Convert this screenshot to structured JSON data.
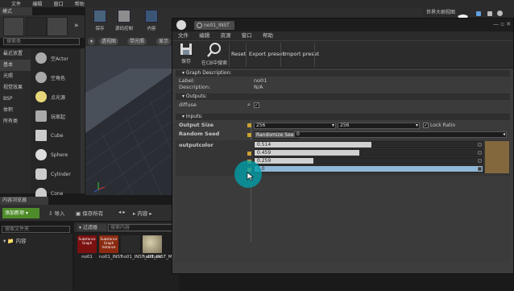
{
  "editor_menu": [
    "文件",
    "编辑",
    "窗口",
    "帮助"
  ],
  "modes": {
    "tab_label": "模式",
    "search_placeholder": "搜索类",
    "categories": [
      "最近放置",
      "基本",
      "光照",
      "视觉效果",
      "BSP",
      "体积",
      "所有类"
    ],
    "items": [
      "空Actor",
      "空角色",
      "点光源",
      "玩家起",
      "Cube",
      "Sphere",
      "Cylinder",
      "Cone"
    ]
  },
  "level_toolbar": {
    "save": "保存",
    "source_control": "源码控制",
    "content": "内容"
  },
  "viewport": {
    "perspective": "透视图",
    "lit": "带光照",
    "show": "显示"
  },
  "outliner_title": "世界大纲视图",
  "content_browser": {
    "tab": "内容浏览器",
    "add_new": "添加新项",
    "import": "导入",
    "save_all": "保存所有",
    "path": "内容",
    "filter_placeholder": "搜索文件夹",
    "filters": "过滤器",
    "search_placeholder": "搜索内容",
    "tree_folder": "内容",
    "assets": [
      {
        "name": "no01",
        "thumb": "Substance Graph",
        "color": "#7a1010"
      },
      {
        "name": "no01_INST",
        "thumb": "Substance Graph Instance",
        "color": "#8a2a10"
      },
      {
        "name": "no01_INST_diffuse",
        "thumb": "",
        "color": "#2a2a2a"
      },
      {
        "name": "no01_INST_MAT",
        "thumb": "",
        "color": "#a49a7a"
      }
    ]
  },
  "material_window": {
    "tab_title": "no01_INST",
    "menu": [
      "文件",
      "编辑",
      "资源",
      "窗口",
      "帮助"
    ],
    "toolbar": {
      "save": "保存",
      "find_in_cb": "在CB中搜索",
      "reset": "Reset",
      "export_preset": "Export preset",
      "import_preset": "Import preset"
    },
    "graph_description": {
      "section": "Graph Description:",
      "label_key": "Label:",
      "label_value": "no01",
      "description_key": "Description:",
      "description_value": "N/A"
    },
    "outputs": {
      "section": "Outputs:",
      "diffuse": "diffuse"
    },
    "inputs": {
      "section": "Inputs:",
      "output_size_label": "Output Size",
      "output_size_x": "256",
      "output_size_y": "256",
      "lock_ratio": "Lock Ratio",
      "random_seed_label": "Random Seed",
      "randomize_button": "Randomize Seed",
      "random_seed_value": "0",
      "outputcolor_label": "outputcolor",
      "outputcolor_values": [
        "0.514",
        "0.459",
        "0.259",
        "1.0"
      ],
      "outputcolor_fractions": [
        0.514,
        0.459,
        0.259,
        1.0
      ],
      "swatch_color": "#83683e"
    }
  }
}
